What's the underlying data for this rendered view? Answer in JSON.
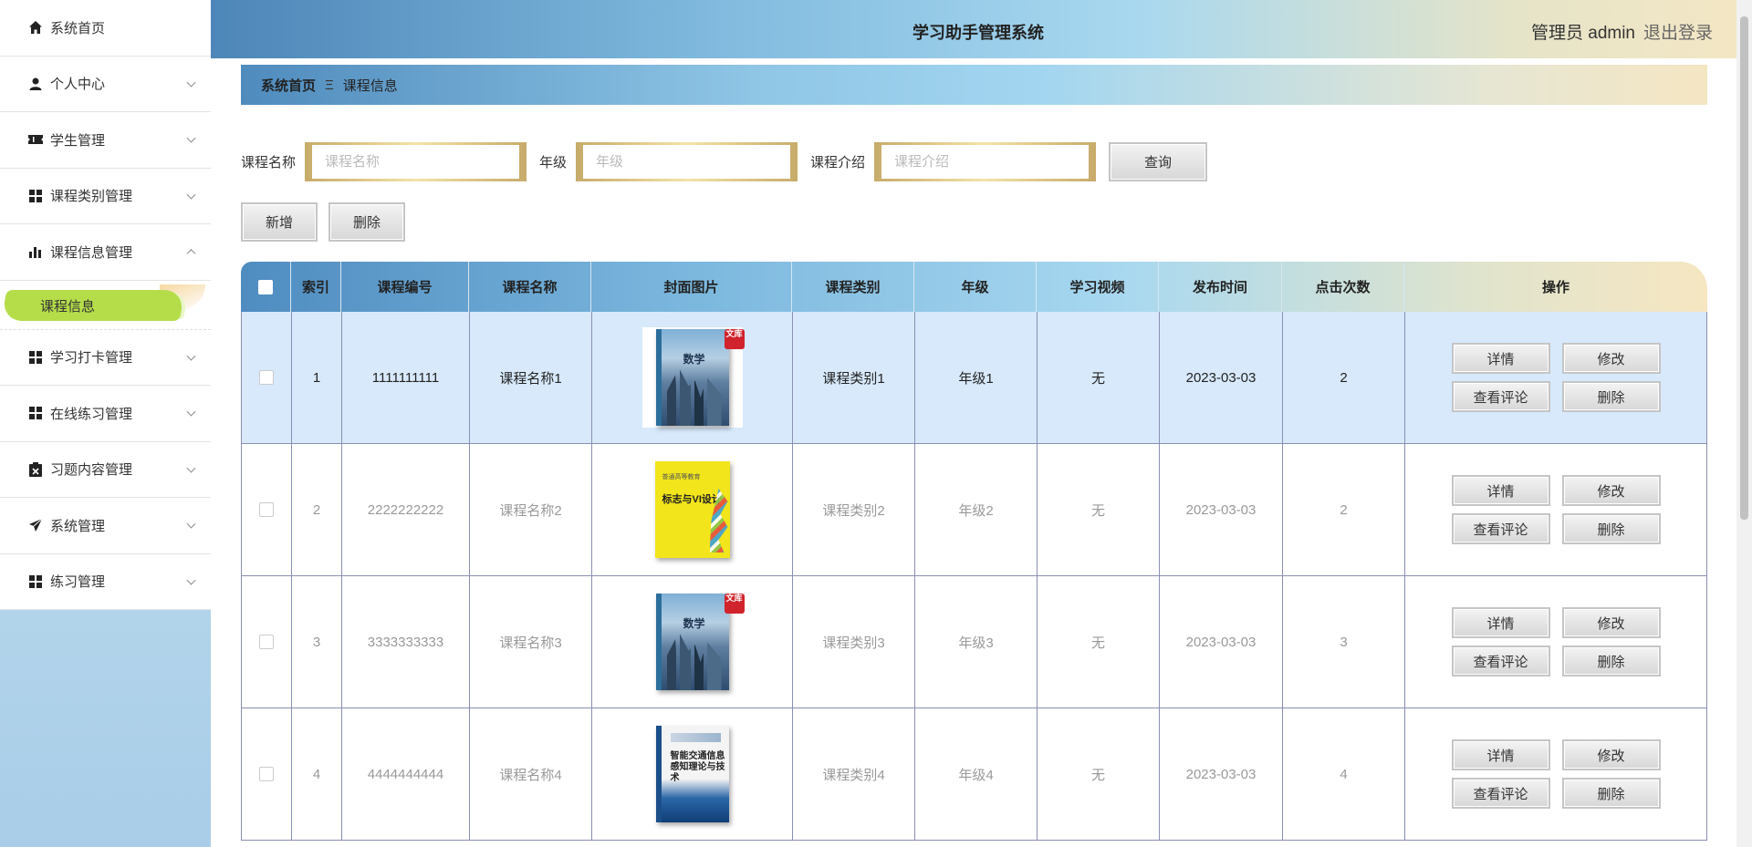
{
  "app": {
    "title": "学习助手管理系统",
    "user_label": "管理员 admin",
    "logout_label": "退出登录"
  },
  "sidebar": {
    "items": [
      {
        "label": "系统首页",
        "icon": "home-icon"
      },
      {
        "label": "个人中心",
        "icon": "user-icon"
      },
      {
        "label": "学生管理",
        "icon": "ticket-icon"
      },
      {
        "label": "课程类别管理",
        "icon": "grid-icon"
      },
      {
        "label": "课程信息管理",
        "icon": "bar-chart-icon"
      },
      {
        "label": "学习打卡管理",
        "icon": "grid-icon"
      },
      {
        "label": "在线练习管理",
        "icon": "grid-icon"
      },
      {
        "label": "习题内容管理",
        "icon": "clipboard-x-icon"
      },
      {
        "label": "系统管理",
        "icon": "send-icon"
      },
      {
        "label": "练习管理",
        "icon": "grid-icon"
      }
    ],
    "active_sub": "课程信息"
  },
  "breadcrumb": {
    "home": "系统首页",
    "separator": "Ξ",
    "current": "课程信息"
  },
  "search": {
    "name_label": "课程名称",
    "name_placeholder": "课程名称",
    "grade_label": "年级",
    "grade_placeholder": "年级",
    "intro_label": "课程介绍",
    "intro_placeholder": "课程介绍",
    "query_label": "查询"
  },
  "actions": {
    "add_label": "新增",
    "delete_label": "删除"
  },
  "table": {
    "headers": [
      "索引",
      "课程编号",
      "课程名称",
      "封面图片",
      "课程类别",
      "年级",
      "学习视频",
      "发布时间",
      "点击次数",
      "操作"
    ],
    "row_actions": {
      "detail": "详情",
      "edit": "修改",
      "comments": "查看评论",
      "delete": "删除"
    },
    "rows": [
      {
        "index": "1",
        "code": "1111111111",
        "name": "课程名称1",
        "cover": "math-book",
        "category": "课程类别1",
        "grade": "年级1",
        "video": "无",
        "date": "2023-03-03",
        "clicks": "2",
        "selected": true
      },
      {
        "index": "2",
        "code": "2222222222",
        "name": "课程名称2",
        "cover": "vi-design-book",
        "category": "课程类别2",
        "grade": "年级2",
        "video": "无",
        "date": "2023-03-03",
        "clicks": "2",
        "selected": false
      },
      {
        "index": "3",
        "code": "3333333333",
        "name": "课程名称3",
        "cover": "math-book",
        "category": "课程类别3",
        "grade": "年级3",
        "video": "无",
        "date": "2023-03-03",
        "clicks": "3",
        "selected": false
      },
      {
        "index": "4",
        "code": "4444444444",
        "name": "课程名称4",
        "cover": "traffic-book",
        "category": "课程类别4",
        "grade": "年级4",
        "video": "无",
        "date": "2023-03-03",
        "clicks": "4",
        "selected": false
      }
    ]
  },
  "covers": {
    "math_title": "数学",
    "stamp_text": "文库",
    "vi_top": "普通高等教育",
    "vi_title": "标志与VI设计",
    "traffic_title": "智能交通信息感知理论与技术"
  }
}
